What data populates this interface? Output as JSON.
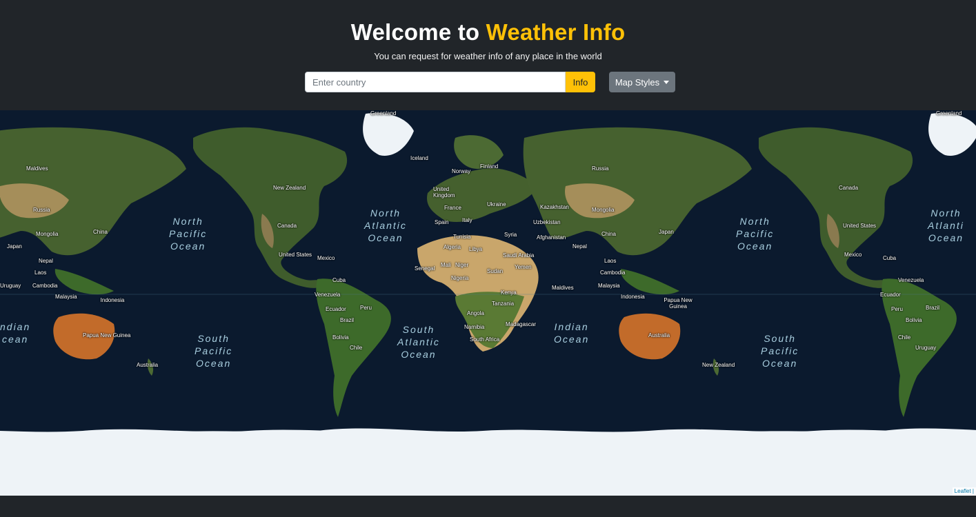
{
  "header": {
    "title_prefix": "Welcome to ",
    "title_accent": "Weather Info",
    "subtitle": "You can request for weather info of any place in the world"
  },
  "search": {
    "placeholder": "Enter country",
    "value": "",
    "button_label": "Info"
  },
  "map_styles": {
    "label": "Map Styles",
    "icon": "caret-down-icon"
  },
  "map": {
    "attribution": "Leaflet |",
    "colors": {
      "ocean": "#0b1a2e",
      "land": "#3d5a2a",
      "desert": "#c9a66b",
      "ice": "#eef3f7"
    },
    "countries": [
      "Greenland",
      "Iceland",
      "Norway",
      "Finland",
      "United Kingdom",
      "France",
      "Spain",
      "Italy",
      "Ukraine",
      "Kazakhstan",
      "Uzbekistan",
      "Afghanistan",
      "Russia",
      "Mongolia",
      "China",
      "Japan",
      "Nepal",
      "Laos",
      "Cambodia",
      "Malaysia",
      "Indonesia",
      "Papua New Guinea",
      "Australia",
      "New Zealand",
      "Canada",
      "United States",
      "Mexico",
      "Cuba",
      "Venezuela",
      "Ecuador",
      "Peru",
      "Brazil",
      "Bolivia",
      "Chile",
      "Uruguay",
      "Tunisia",
      "Algeria",
      "Libya",
      "Syria",
      "Saudi Arabia",
      "Yemen",
      "Senegal",
      "Mali",
      "Niger",
      "Nigeria",
      "Sudan",
      "Kenya",
      "Tanzania",
      "Angola",
      "Namibia",
      "South Africa",
      "Madagascar",
      "Maldives",
      "Russia",
      "Mongolia",
      "China",
      "Japan",
      "Nepal",
      "Laos",
      "Cambodia",
      "Malaysia",
      "Indonesia",
      "Papua New Guinea",
      "Australia",
      "New Zealand",
      "Canada",
      "United States",
      "Mexico",
      "Cuba",
      "Venezuela",
      "Ecuador",
      "Peru",
      "Brazil",
      "Bolivia",
      "Chile",
      "Uruguay",
      "Greenland",
      "Maldives"
    ],
    "oceans": [
      "North\nPacific\nOcean",
      "North\nAtlantic\nOcean",
      "South\nAtlantic\nOcean",
      "Indian\nOcean",
      "South\nPacific\nOcean",
      "North\nPacific\nOcean",
      "South\nPacific\nOcean",
      "North\nAtlanti\nOcean",
      "ndian\ncean"
    ]
  }
}
